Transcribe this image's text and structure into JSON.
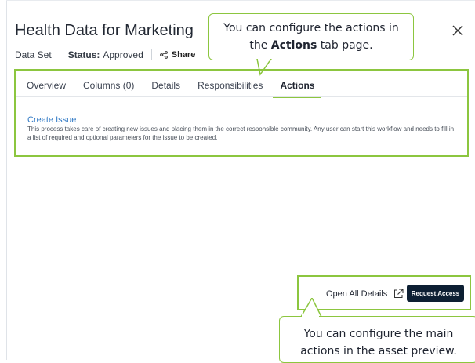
{
  "asset": {
    "title": "Health Data for Marketing",
    "type": "Data Set",
    "status_label": "Status:",
    "status_value": "Approved",
    "share_label": "Share"
  },
  "tabs": [
    {
      "label": "Overview",
      "active": false
    },
    {
      "label": "Columns (0)",
      "active": false
    },
    {
      "label": "Details",
      "active": false
    },
    {
      "label": "Responsibilities",
      "active": false
    },
    {
      "label": "Actions",
      "active": true
    }
  ],
  "actions": {
    "issue_title": "Create Issue",
    "issue_description": "This process takes care of creating new issues and placing them in the correct responsible community. Any user can start this workflow and needs to fill in a list of required and optional parameters for the issue to be created."
  },
  "footer": {
    "open_all_label": "Open All Details",
    "request_access_label": "Request Access"
  },
  "callouts": {
    "top_line1": "You can configure the actions in",
    "top_line2_pre": "the ",
    "top_line2_bold": "Actions",
    "top_line2_post": " tab page.",
    "bottom_line1": "You can configure the main",
    "bottom_line2": "actions in the asset preview."
  },
  "icons": {
    "share": "share-icon",
    "close": "close-icon",
    "external_link": "external-link-icon"
  },
  "colors": {
    "highlight_green": "#8cc63f",
    "link_blue": "#2f78c4",
    "primary_button": "#0d1f33"
  }
}
